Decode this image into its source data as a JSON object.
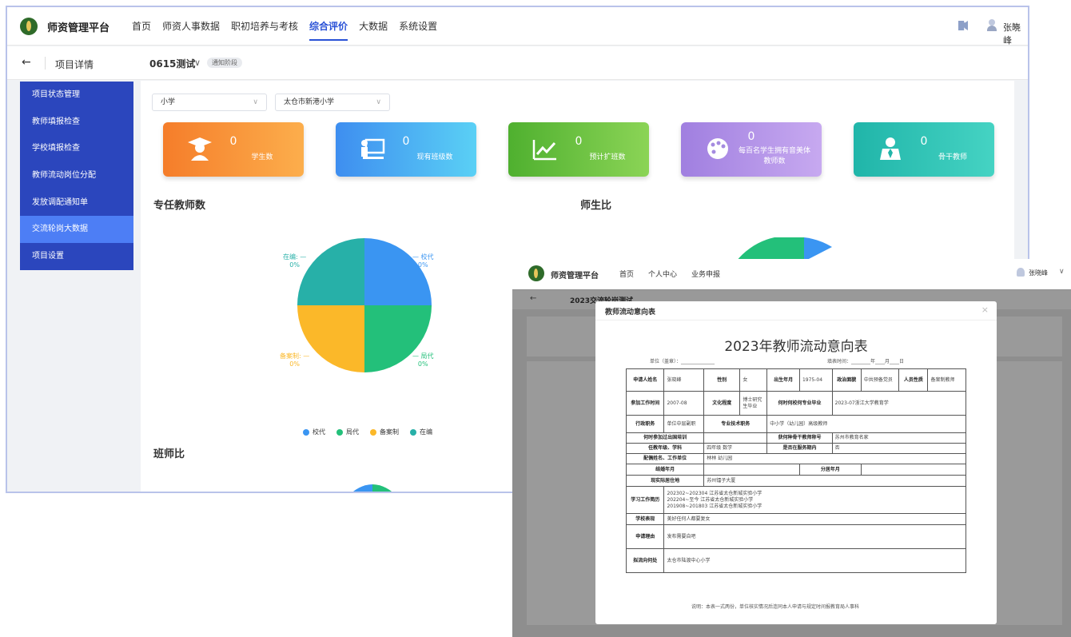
{
  "app": {
    "brand": "师资管理平台",
    "nav": [
      "首页",
      "师资人事数据",
      "职初培养与考核",
      "综合评价",
      "大数据",
      "系统设置"
    ],
    "active_nav": "综合评价",
    "user": "张晓峰",
    "back_label": "项目详情",
    "project": "0615测试",
    "project_badge": "通知阶段"
  },
  "sidebar": {
    "items": [
      "项目状态管理",
      "教师填报检查",
      "学校填报检查",
      "教师流动岗位分配",
      "发放调配通知单",
      "交流轮岗大数据",
      "项目设置"
    ],
    "selected": "交流轮岗大数据"
  },
  "filters": {
    "level": "小学",
    "school": "太仓市新港小学"
  },
  "cards": [
    {
      "value": "0",
      "label": "学生数",
      "color": "#f57d2a",
      "icon": "student-icon"
    },
    {
      "value": "0",
      "label": "现有班级数",
      "color": "#3ea0f0",
      "icon": "classroom-icon"
    },
    {
      "value": "0",
      "label": "预计扩班数",
      "color": "#5fbd3a",
      "icon": "trend-icon"
    },
    {
      "value": "0",
      "label": "每百名学生拥有音美体教师数",
      "color": "#a58be0",
      "icon": "palette-icon"
    },
    {
      "value": "0",
      "label": "骨干教师",
      "color": "#2fbfb0",
      "icon": "teacher-icon"
    }
  ],
  "sections": {
    "full_time": "专任教师数",
    "ratio": "师生比",
    "class_ratio": "班师比"
  },
  "chart_data": {
    "type": "pie",
    "title": "专任教师数",
    "categories": [
      "校代",
      "局代",
      "备案制",
      "在编"
    ],
    "values": [
      0,
      0,
      0,
      0
    ],
    "value_labels": [
      "0%",
      "0%",
      "0%",
      "0%"
    ],
    "colors": [
      "#3a95f2",
      "#23c07a",
      "#fbb829",
      "#27b0a8"
    ],
    "legend": "bottom"
  },
  "overlay": {
    "brand": "师资管理平台",
    "nav": [
      "首页",
      "个人中心",
      "业务申报"
    ],
    "user": "张晓峰",
    "sub_title": "2023交流轮岗测试",
    "modal_title": "教师流动意向表",
    "form_title": "2023年教师流动意向表",
    "unit_label": "单位（盖章）：",
    "fill_time": "填表时间：",
    "year": "年",
    "month": "月",
    "day": "日",
    "fields": {
      "name_label": "申请人姓名",
      "name": "张晓峰",
      "sex_label": "性别",
      "sex": "女",
      "birth_label": "出生年月",
      "birth": "1975-04",
      "politics_label": "政治面貌",
      "politics": "中共预备党员",
      "type_label": "人员性质",
      "type": "备案制教师",
      "work_label": "参加工作时间",
      "work": "2007-08",
      "edu_label": "文化程度",
      "edu": "博士研究生毕业",
      "grad_label": "何时何校何专业毕业",
      "grad": "2023-07浙江大学教育学",
      "admin_label": "行政职务",
      "admin": "单位中层副职",
      "tech_label": "专业技术职务",
      "tech": "中小学（幼儿园）高级教师",
      "abroad_label": "何时参加过出国培训",
      "abroad": "",
      "honor_label": "获何种骨干教师称号",
      "honor": "苏州市教育名家",
      "grade_label": "任教年级、学科",
      "grade": "四年级 数学",
      "service_label": "是否在服务期内",
      "service": "否",
      "spouse_label": "配偶姓名、工作单位",
      "spouse": "林林 幼儿园",
      "married_label": "结婚年月",
      "married": "",
      "separate_label": "分居年月",
      "separate": "",
      "address_label": "现实际居住地",
      "address": "苏州镭子大厦",
      "resume_label": "学习工作简历",
      "resume": [
        "202302~202304 江苏省太仓新城实验小学",
        "202204~至今 江苏省太仓新城实验小学",
        "201908~201803 江苏省太仓新城实验小学"
      ],
      "perf_label": "学校表现",
      "perf": "美好任何人都要复女",
      "reason_label": "申请理由",
      "reason": "发布需要自吧",
      "dest_label": "拟流向何处",
      "dest": "太仓市陆渡中心小学"
    },
    "note": "说明：本表一式两份，单位核实情况后连同本人申请与规定时间报教育局人事科"
  }
}
